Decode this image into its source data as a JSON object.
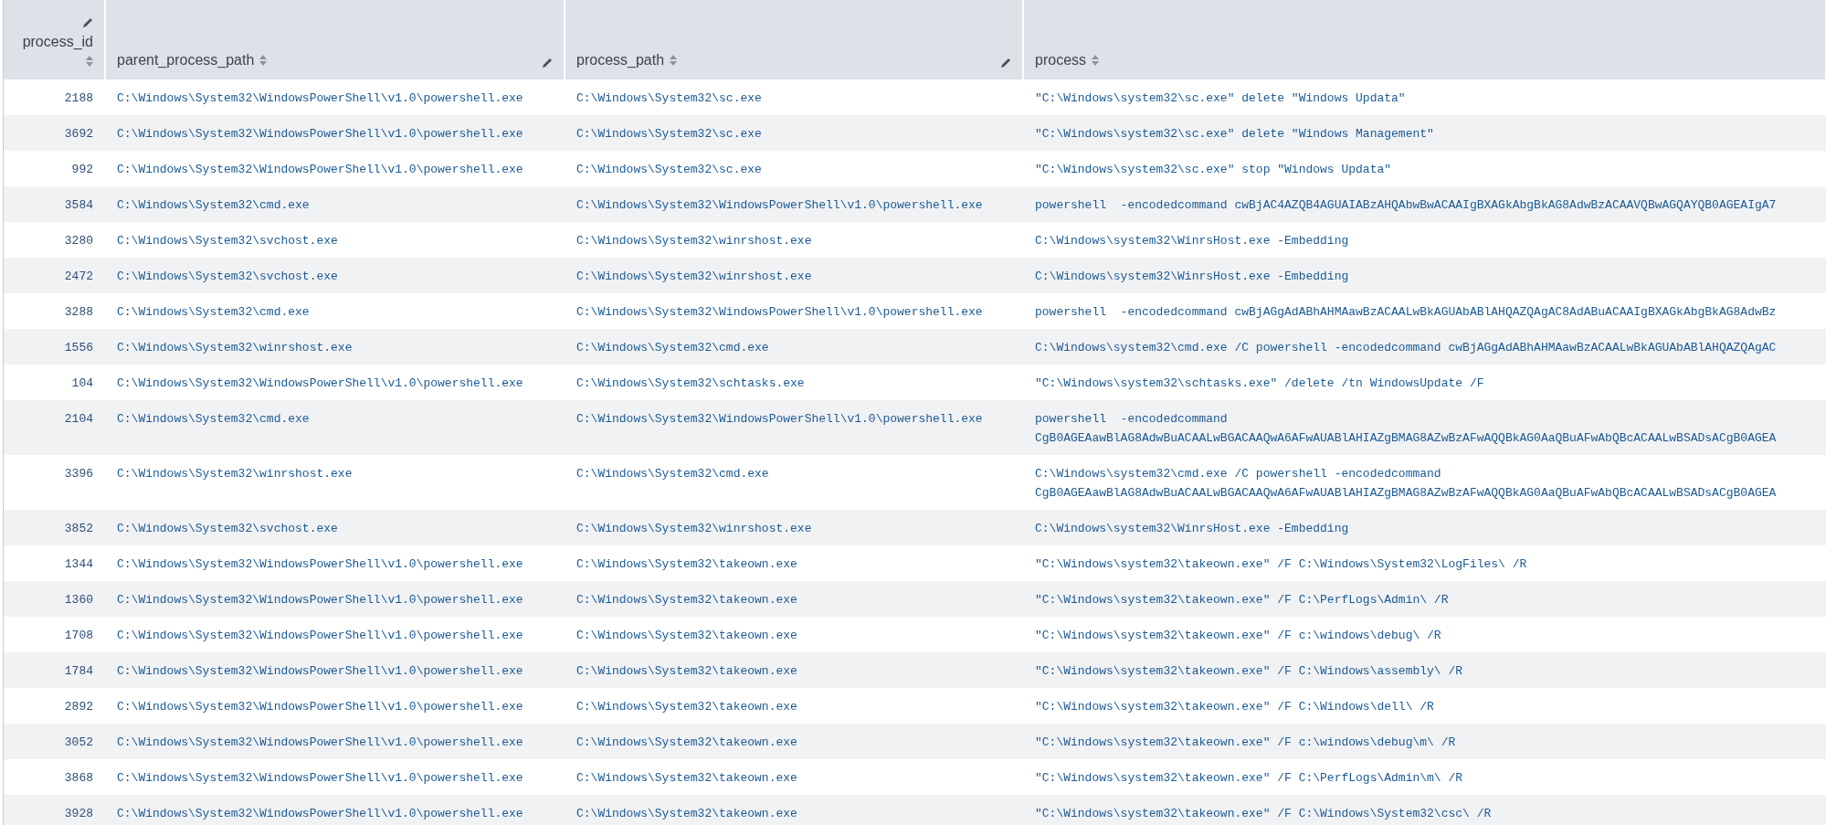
{
  "table": {
    "columns": [
      {
        "label": "process_id",
        "editable": true,
        "sortable": true,
        "kind": "number"
      },
      {
        "label": "parent_process_path",
        "editable": true,
        "sortable": true,
        "kind": "text"
      },
      {
        "label": "process_path",
        "editable": true,
        "sortable": true,
        "kind": "text"
      },
      {
        "label": "process",
        "editable": false,
        "sortable": true,
        "kind": "text"
      }
    ],
    "rows": [
      [
        "2188",
        "C:\\Windows\\System32\\WindowsPowerShell\\v1.0\\powershell.exe",
        "C:\\Windows\\System32\\sc.exe",
        "\"C:\\Windows\\system32\\sc.exe\" delete \"Windows Updata\""
      ],
      [
        "3692",
        "C:\\Windows\\System32\\WindowsPowerShell\\v1.0\\powershell.exe",
        "C:\\Windows\\System32\\sc.exe",
        "\"C:\\Windows\\system32\\sc.exe\" delete \"Windows Management\""
      ],
      [
        "992",
        "C:\\Windows\\System32\\WindowsPowerShell\\v1.0\\powershell.exe",
        "C:\\Windows\\System32\\sc.exe",
        "\"C:\\Windows\\system32\\sc.exe\" stop \"Windows Updata\""
      ],
      [
        "3584",
        "C:\\Windows\\System32\\cmd.exe",
        "C:\\Windows\\System32\\WindowsPowerShell\\v1.0\\powershell.exe",
        "powershell  -encodedcommand cwBjAC4AZQB4AGUAIABzAHQAbwBwACAAIgBXAGkAbgBkAG8AdwBzACAAVQBwAGQAYQB0AGEAIgA7"
      ],
      [
        "3280",
        "C:\\Windows\\System32\\svchost.exe",
        "C:\\Windows\\System32\\winrshost.exe",
        "C:\\Windows\\system32\\WinrsHost.exe -Embedding"
      ],
      [
        "2472",
        "C:\\Windows\\System32\\svchost.exe",
        "C:\\Windows\\System32\\winrshost.exe",
        "C:\\Windows\\system32\\WinrsHost.exe -Embedding"
      ],
      [
        "3288",
        "C:\\Windows\\System32\\cmd.exe",
        "C:\\Windows\\System32\\WindowsPowerShell\\v1.0\\powershell.exe",
        "powershell  -encodedcommand cwBjAGgAdABhAHMAawBzACAALwBkAGUAbABlAHQAZQAgAC8AdABuACAAIgBXAGkAbgBkAG8AdwBz"
      ],
      [
        "1556",
        "C:\\Windows\\System32\\winrshost.exe",
        "C:\\Windows\\System32\\cmd.exe",
        "C:\\Windows\\system32\\cmd.exe /C powershell -encodedcommand cwBjAGgAdABhAHMAawBzACAALwBkAGUAbABlAHQAZQAgAC"
      ],
      [
        "104",
        "C:\\Windows\\System32\\WindowsPowerShell\\v1.0\\powershell.exe",
        "C:\\Windows\\System32\\schtasks.exe",
        "\"C:\\Windows\\system32\\schtasks.exe\" /delete /tn WindowsUpdate /F"
      ],
      [
        "2104",
        "C:\\Windows\\System32\\cmd.exe",
        "C:\\Windows\\System32\\WindowsPowerShell\\v1.0\\powershell.exe",
        "powershell  -encodedcommand CgB0AGEAawBlAG8AdwBuACAALwBGACAAQwA6AFwAUABlAHIAZgBMAG8AZwBzAFwAQQBkAG0AaQBuAFwAbQBcACAALwBSADsACgB0AGEA"
      ],
      [
        "3396",
        "C:\\Windows\\System32\\winrshost.exe",
        "C:\\Windows\\System32\\cmd.exe",
        "C:\\Windows\\system32\\cmd.exe /C powershell -encodedcommand CgB0AGEAawBlAG8AdwBuACAALwBGACAAQwA6AFwAUABlAHIAZgBMAG8AZwBzAFwAQQBkAG0AaQBuAFwAbQBcACAALwBSADsACgB0AGEA"
      ],
      [
        "3852",
        "C:\\Windows\\System32\\svchost.exe",
        "C:\\Windows\\System32\\winrshost.exe",
        "C:\\Windows\\system32\\WinrsHost.exe -Embedding"
      ],
      [
        "1344",
        "C:\\Windows\\System32\\WindowsPowerShell\\v1.0\\powershell.exe",
        "C:\\Windows\\System32\\takeown.exe",
        "\"C:\\Windows\\system32\\takeown.exe\" /F C:\\Windows\\System32\\LogFiles\\ /R"
      ],
      [
        "1360",
        "C:\\Windows\\System32\\WindowsPowerShell\\v1.0\\powershell.exe",
        "C:\\Windows\\System32\\takeown.exe",
        "\"C:\\Windows\\system32\\takeown.exe\" /F C:\\PerfLogs\\Admin\\ /R"
      ],
      [
        "1708",
        "C:\\Windows\\System32\\WindowsPowerShell\\v1.0\\powershell.exe",
        "C:\\Windows\\System32\\takeown.exe",
        "\"C:\\Windows\\system32\\takeown.exe\" /F c:\\windows\\debug\\ /R"
      ],
      [
        "1784",
        "C:\\Windows\\System32\\WindowsPowerShell\\v1.0\\powershell.exe",
        "C:\\Windows\\System32\\takeown.exe",
        "\"C:\\Windows\\system32\\takeown.exe\" /F C:\\Windows\\assembly\\ /R"
      ],
      [
        "2892",
        "C:\\Windows\\System32\\WindowsPowerShell\\v1.0\\powershell.exe",
        "C:\\Windows\\System32\\takeown.exe",
        "\"C:\\Windows\\system32\\takeown.exe\" /F C:\\Windows\\dell\\ /R"
      ],
      [
        "3052",
        "C:\\Windows\\System32\\WindowsPowerShell\\v1.0\\powershell.exe",
        "C:\\Windows\\System32\\takeown.exe",
        "\"C:\\Windows\\system32\\takeown.exe\" /F c:\\windows\\debug\\m\\ /R"
      ],
      [
        "3868",
        "C:\\Windows\\System32\\WindowsPowerShell\\v1.0\\powershell.exe",
        "C:\\Windows\\System32\\takeown.exe",
        "\"C:\\Windows\\system32\\takeown.exe\" /F C:\\PerfLogs\\Admin\\m\\ /R"
      ],
      [
        "3928",
        "C:\\Windows\\System32\\WindowsPowerShell\\v1.0\\powershell.exe",
        "C:\\Windows\\System32\\takeown.exe",
        "\"C:\\Windows\\system32\\takeown.exe\" /F C:\\Windows\\System32\\csc\\ /R"
      ]
    ]
  }
}
